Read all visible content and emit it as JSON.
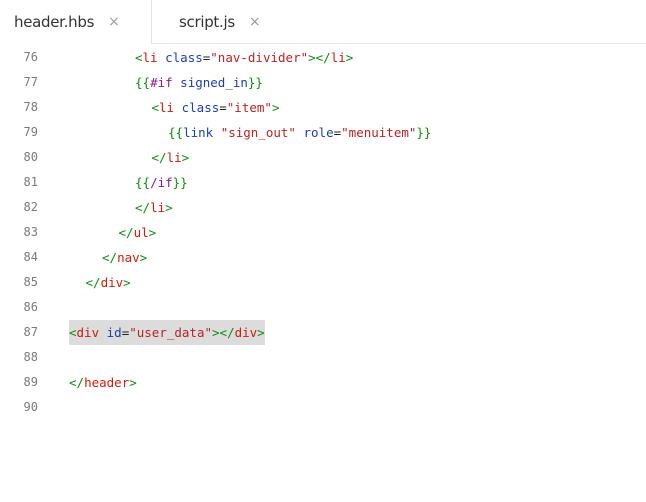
{
  "tabs": [
    {
      "label": "header.hbs",
      "close": "×",
      "active": true
    },
    {
      "label": "script.js",
      "close": "×",
      "active": false
    }
  ],
  "lines": [
    {
      "num": "76",
      "indent": 4,
      "tokens": [
        {
          "t": "<",
          "c": "tag"
        },
        {
          "t": "li",
          "c": "tagname"
        },
        {
          "t": " class",
          "c": "attr"
        },
        {
          "t": "=",
          "c": "plain"
        },
        {
          "t": "\"nav-divider\"",
          "c": "str"
        },
        {
          "t": "></",
          "c": "tag"
        },
        {
          "t": "li",
          "c": "tagname"
        },
        {
          "t": ">",
          "c": "tag"
        }
      ]
    },
    {
      "num": "77",
      "indent": 4,
      "tokens": [
        {
          "t": "{{",
          "c": "brace"
        },
        {
          "t": "#if",
          "c": "kw"
        },
        {
          "t": " signed_in",
          "c": "name"
        },
        {
          "t": "}}",
          "c": "brace"
        }
      ]
    },
    {
      "num": "78",
      "indent": 5,
      "tokens": [
        {
          "t": "<",
          "c": "tag"
        },
        {
          "t": "li",
          "c": "tagname"
        },
        {
          "t": " class",
          "c": "attr"
        },
        {
          "t": "=",
          "c": "plain"
        },
        {
          "t": "\"item\"",
          "c": "str"
        },
        {
          "t": ">",
          "c": "tag"
        }
      ]
    },
    {
      "num": "79",
      "indent": 6,
      "tokens": [
        {
          "t": "{{",
          "c": "brace"
        },
        {
          "t": "link",
          "c": "name"
        },
        {
          "t": " ",
          "c": "plain"
        },
        {
          "t": "\"sign_out\"",
          "c": "str"
        },
        {
          "t": " role",
          "c": "attr"
        },
        {
          "t": "=",
          "c": "plain"
        },
        {
          "t": "\"menuitem\"",
          "c": "str"
        },
        {
          "t": "}}",
          "c": "brace"
        }
      ]
    },
    {
      "num": "80",
      "indent": 5,
      "tokens": [
        {
          "t": "</",
          "c": "tag"
        },
        {
          "t": "li",
          "c": "tagname"
        },
        {
          "t": ">",
          "c": "tag"
        }
      ]
    },
    {
      "num": "81",
      "indent": 4,
      "tokens": [
        {
          "t": "{{",
          "c": "brace"
        },
        {
          "t": "/if",
          "c": "kw"
        },
        {
          "t": "}}",
          "c": "brace"
        }
      ]
    },
    {
      "num": "82",
      "indent": 4,
      "tokens": [
        {
          "t": "</",
          "c": "tag"
        },
        {
          "t": "li",
          "c": "tagname"
        },
        {
          "t": ">",
          "c": "tag"
        }
      ]
    },
    {
      "num": "83",
      "indent": 3,
      "tokens": [
        {
          "t": "</",
          "c": "tag"
        },
        {
          "t": "ul",
          "c": "tagname"
        },
        {
          "t": ">",
          "c": "tag"
        }
      ]
    },
    {
      "num": "84",
      "indent": 2,
      "tokens": [
        {
          "t": "</",
          "c": "tag"
        },
        {
          "t": "nav",
          "c": "tagname"
        },
        {
          "t": ">",
          "c": "tag"
        }
      ]
    },
    {
      "num": "85",
      "indent": 1,
      "tokens": [
        {
          "t": "</",
          "c": "tag"
        },
        {
          "t": "div",
          "c": "tagname"
        },
        {
          "t": ">",
          "c": "tag"
        }
      ]
    },
    {
      "num": "86",
      "indent": 0,
      "tokens": []
    },
    {
      "num": "87",
      "indent": 0,
      "highlighted": true,
      "tokens": [
        {
          "t": "<",
          "c": "tag"
        },
        {
          "t": "div",
          "c": "tagname"
        },
        {
          "t": " id",
          "c": "attr"
        },
        {
          "t": "=",
          "c": "plain"
        },
        {
          "t": "\"user_data\"",
          "c": "str"
        },
        {
          "t": "></",
          "c": "tag"
        },
        {
          "t": "div",
          "c": "tagname"
        },
        {
          "t": ">",
          "c": "tag"
        }
      ]
    },
    {
      "num": "88",
      "indent": 0,
      "tokens": []
    },
    {
      "num": "89",
      "indent": 0,
      "tokens": [
        {
          "t": "</",
          "c": "tag"
        },
        {
          "t": "header",
          "c": "tagname"
        },
        {
          "t": ">",
          "c": "tag"
        }
      ]
    },
    {
      "num": "90",
      "indent": 0,
      "tokens": []
    }
  ]
}
